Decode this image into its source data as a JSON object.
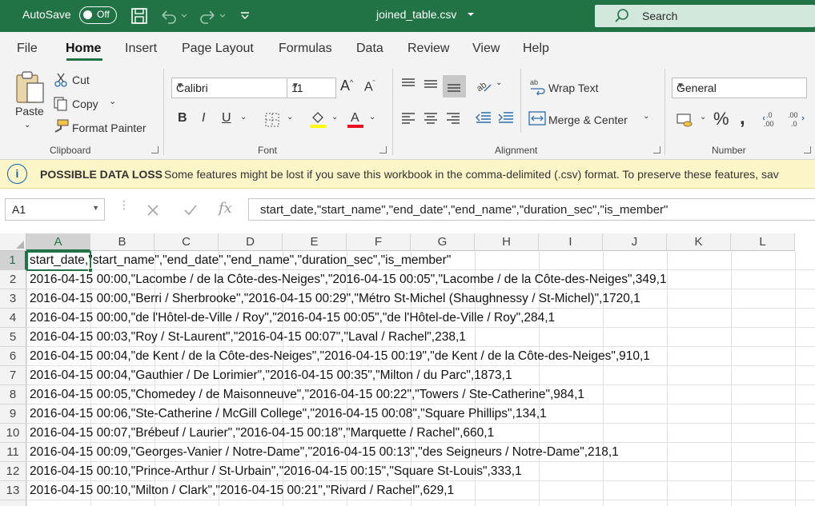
{
  "titlebar": {
    "autosave_label": "AutoSave",
    "autosave_state": "Off",
    "filename": "joined_table.csv",
    "search_placeholder": "Search"
  },
  "tabs": [
    "File",
    "Home",
    "Insert",
    "Page Layout",
    "Formulas",
    "Data",
    "Review",
    "View",
    "Help"
  ],
  "active_tab": "Home",
  "ribbon": {
    "clipboard": {
      "paste": "Paste",
      "cut": "Cut",
      "copy": "Copy",
      "format_painter": "Format Painter",
      "label": "Clipboard"
    },
    "font": {
      "name": "Calibri",
      "size": "11",
      "label": "Font"
    },
    "alignment": {
      "wrap_text": "Wrap Text",
      "merge_center": "Merge & Center",
      "label": "Alignment"
    },
    "number": {
      "format": "General",
      "label": "Number"
    },
    "colors": {
      "highlight": "#ffff00",
      "font_color": "#e81123"
    }
  },
  "infobar": {
    "title": "POSSIBLE DATA LOSS",
    "message": "Some features might be lost if you save this workbook in the comma-delimited (.csv) format. To preserve these features, sav"
  },
  "formula_bar": {
    "name_box": "A1",
    "fx": "fx",
    "content": "start_date,\"start_name\",\"end_date\",\"end_name\",\"duration_sec\",\"is_member\""
  },
  "grid": {
    "columns": [
      "A",
      "B",
      "C",
      "D",
      "E",
      "F",
      "G",
      "H",
      "I",
      "J",
      "K",
      "L"
    ],
    "selected_cell": "A1",
    "rows": [
      {
        "n": "1",
        "text": "start_date,\"start_name\",\"end_date\",\"end_name\",\"duration_sec\",\"is_member\""
      },
      {
        "n": "2",
        "text": "2016-04-15 00:00,\"Lacombe / de la Côte-des-Neiges\",\"2016-04-15 00:05\",\"Lacombe / de la Côte-des-Neiges\",349,1"
      },
      {
        "n": "3",
        "text": "2016-04-15 00:00,\"Berri / Sherbrooke\",\"2016-04-15 00:29\",\"Métro St-Michel (Shaughnessy / St-Michel)\",1720,1"
      },
      {
        "n": "4",
        "text": "2016-04-15 00:00,\"de l'Hôtel-de-Ville / Roy\",\"2016-04-15 00:05\",\"de l'Hôtel-de-Ville / Roy\",284,1"
      },
      {
        "n": "5",
        "text": "2016-04-15 00:03,\"Roy / St-Laurent\",\"2016-04-15 00:07\",\"Laval / Rachel\",238,1"
      },
      {
        "n": "6",
        "text": "2016-04-15 00:04,\"de Kent / de la Côte-des-Neiges\",\"2016-04-15 00:19\",\"de Kent / de la Côte-des-Neiges\",910,1"
      },
      {
        "n": "7",
        "text": "2016-04-15 00:04,\"Gauthier / De Lorimier\",\"2016-04-15 00:35\",\"Milton / du Parc\",1873,1"
      },
      {
        "n": "8",
        "text": "2016-04-15 00:05,\"Chomedey / de Maisonneuve\",\"2016-04-15 00:22\",\"Towers / Ste-Catherine\",984,1"
      },
      {
        "n": "9",
        "text": "2016-04-15 00:06,\"Ste-Catherine / McGill College\",\"2016-04-15 00:08\",\"Square Phillips\",134,1"
      },
      {
        "n": "10",
        "text": "2016-04-15 00:07,\"Brébeuf / Laurier\",\"2016-04-15 00:18\",\"Marquette / Rachel\",660,1"
      },
      {
        "n": "11",
        "text": "2016-04-15 00:09,\"Georges-Vanier / Notre-Dame\",\"2016-04-15 00:13\",\"des Seigneurs / Notre-Dame\",218,1"
      },
      {
        "n": "12",
        "text": "2016-04-15 00:10,\"Prince-Arthur / St-Urbain\",\"2016-04-15 00:15\",\"Square St-Louis\",333,1"
      },
      {
        "n": "13",
        "text": "2016-04-15 00:10,\"Milton / Clark\",\"2016-04-15 00:21\",\"Rivard / Rachel\",629,1"
      }
    ]
  },
  "accent_color": "#217346"
}
